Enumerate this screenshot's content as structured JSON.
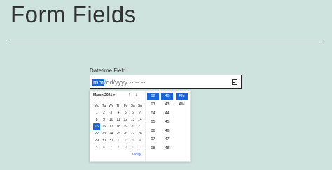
{
  "page": {
    "title": "Form Fields"
  },
  "field": {
    "label": "Datetime Field",
    "segments": {
      "month": "mm",
      "rest": "/dd/yyyy --:-- --"
    }
  },
  "picker": {
    "month_label": "March 2021 ▾",
    "nav_up": "↑",
    "nav_down": "↓",
    "weekdays": [
      "Mo",
      "Tu",
      "We",
      "Th",
      "Fr",
      "Sa",
      "Su"
    ],
    "weeks": [
      [
        "1",
        "2",
        "3",
        "4",
        "5",
        "6",
        "7"
      ],
      [
        "8",
        "9",
        "10",
        "11",
        "12",
        "13",
        "14"
      ],
      [
        "15",
        "16",
        "17",
        "18",
        "19",
        "20",
        "21"
      ],
      [
        "22",
        "23",
        "24",
        "25",
        "26",
        "27",
        "28"
      ],
      [
        "29",
        "30",
        "31",
        "1",
        "2",
        "3",
        "4"
      ],
      [
        "5",
        "6",
        "7",
        "8",
        "9",
        "10",
        "11"
      ]
    ],
    "selected_day": "15",
    "today_label": "Today",
    "hours": [
      "02",
      "03",
      "04",
      "05",
      "06",
      "07",
      "08"
    ],
    "minutes": [
      "43",
      "44",
      "45",
      "46",
      "47",
      "48"
    ],
    "minutes_selected": "40",
    "periods": [
      "PM",
      "AM"
    ],
    "hour_selected": "02"
  }
}
